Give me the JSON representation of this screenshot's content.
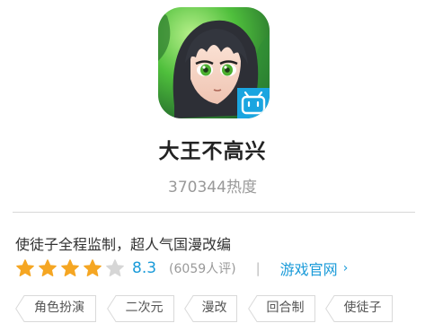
{
  "app": {
    "title": "大王不高兴",
    "heat": "370344热度",
    "description": "使徒子全程监制，超人气国漫改编",
    "icon": "anime-character-app-icon",
    "badge_icon": "bilibili-tv-icon"
  },
  "rating": {
    "stars_filled": 4,
    "stars_total": 5,
    "score": "8.3",
    "count": "(6059人评)",
    "separator": "|",
    "official_site": "游戏官网",
    "official_chevron": "›"
  },
  "tags": [
    "角色扮演",
    "二次元",
    "漫改",
    "回合制",
    "使徒子"
  ],
  "colors": {
    "accent": "#1a9bd9",
    "star_filled": "#f5a623",
    "star_empty": "#d6d6d6",
    "tag_border": "#d9d9d9"
  }
}
